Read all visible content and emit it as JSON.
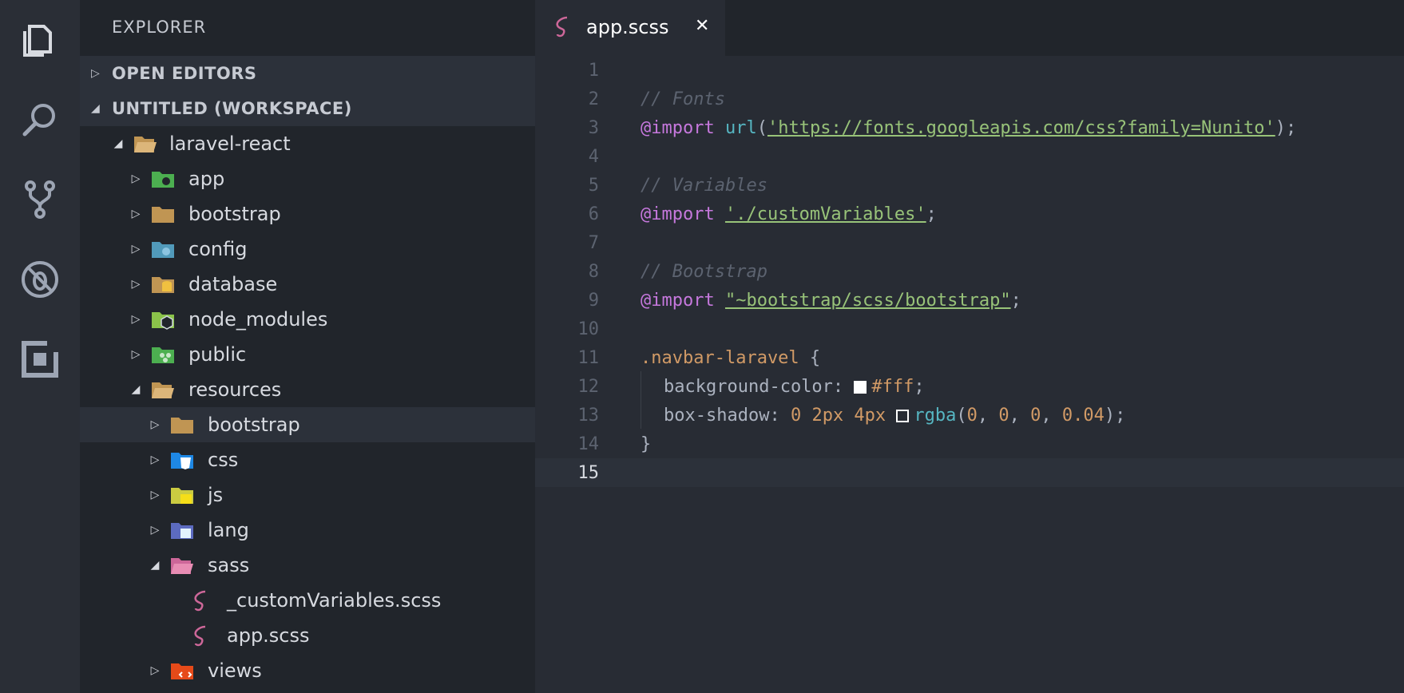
{
  "activity_bar": {
    "icons": [
      "files-icon",
      "search-icon",
      "source-control-icon",
      "debug-icon",
      "extensions-icon"
    ]
  },
  "sidebar": {
    "title": "EXPLORER",
    "sections": [
      {
        "label": "OPEN EDITORS",
        "expanded": false
      },
      {
        "label": "UNTITLED (WORKSPACE)",
        "expanded": true
      }
    ],
    "tree": [
      {
        "label": "laravel-react",
        "expanded": true,
        "icon": "folder-open-icon"
      },
      {
        "label": "app",
        "expanded": false,
        "icon": "folder-app-icon"
      },
      {
        "label": "bootstrap",
        "expanded": false,
        "icon": "folder-icon"
      },
      {
        "label": "config",
        "expanded": false,
        "icon": "folder-config-icon"
      },
      {
        "label": "database",
        "expanded": false,
        "icon": "folder-database-icon"
      },
      {
        "label": "node_modules",
        "expanded": false,
        "icon": "folder-node-icon"
      },
      {
        "label": "public",
        "expanded": false,
        "icon": "folder-public-icon"
      },
      {
        "label": "resources",
        "expanded": true,
        "icon": "folder-open-icon"
      },
      {
        "label": "bootstrap",
        "expanded": false,
        "icon": "folder-icon"
      },
      {
        "label": "css",
        "expanded": false,
        "icon": "folder-css-icon"
      },
      {
        "label": "js",
        "expanded": false,
        "icon": "folder-js-icon"
      },
      {
        "label": "lang",
        "expanded": false,
        "icon": "folder-lang-icon"
      },
      {
        "label": "sass",
        "expanded": true,
        "icon": "folder-sass-icon"
      },
      {
        "label": "_customVariables.scss",
        "icon": "sass-file-icon"
      },
      {
        "label": "app.scss",
        "icon": "sass-file-icon"
      },
      {
        "label": "views",
        "expanded": false,
        "icon": "folder-views-icon"
      }
    ]
  },
  "editor": {
    "tab": {
      "label": "app.scss",
      "close": "✕"
    },
    "lines": [
      "1",
      "2",
      "3",
      "4",
      "5",
      "6",
      "7",
      "8",
      "9",
      "10",
      "11",
      "12",
      "13",
      "14",
      "15"
    ],
    "code": {
      "l2": "// Fonts",
      "l3_kw": "@import",
      "l3_fn": "url",
      "l3_open": "(",
      "l3_str": "'https://fonts.googleapis.com/css?family=Nunito'",
      "l3_close": ");",
      "l5": "// Variables",
      "l6_kw": "@import",
      "l6_str": "'./customVariables'",
      "l6_end": ";",
      "l8": "// Bootstrap",
      "l9_kw": "@import",
      "l9_str": "\"~bootstrap/scss/bootstrap\"",
      "l9_end": ";",
      "l11_sel": ".navbar-laravel",
      "l11_brace": " {",
      "l12_prop": "background-color: ",
      "l12_val": "#fff",
      "l12_end": ";",
      "l13_prop": "box-shadow: ",
      "l13_nums": "0 2px 4px",
      "l13_fn": "rgba",
      "l13_open": "(",
      "l13_a": "0",
      "l13_b": "0",
      "l13_c": "0",
      "l13_d": "0.04",
      "l13_sep": ", ",
      "l13_close": ");",
      "l14": "}"
    },
    "current_line": "15"
  }
}
